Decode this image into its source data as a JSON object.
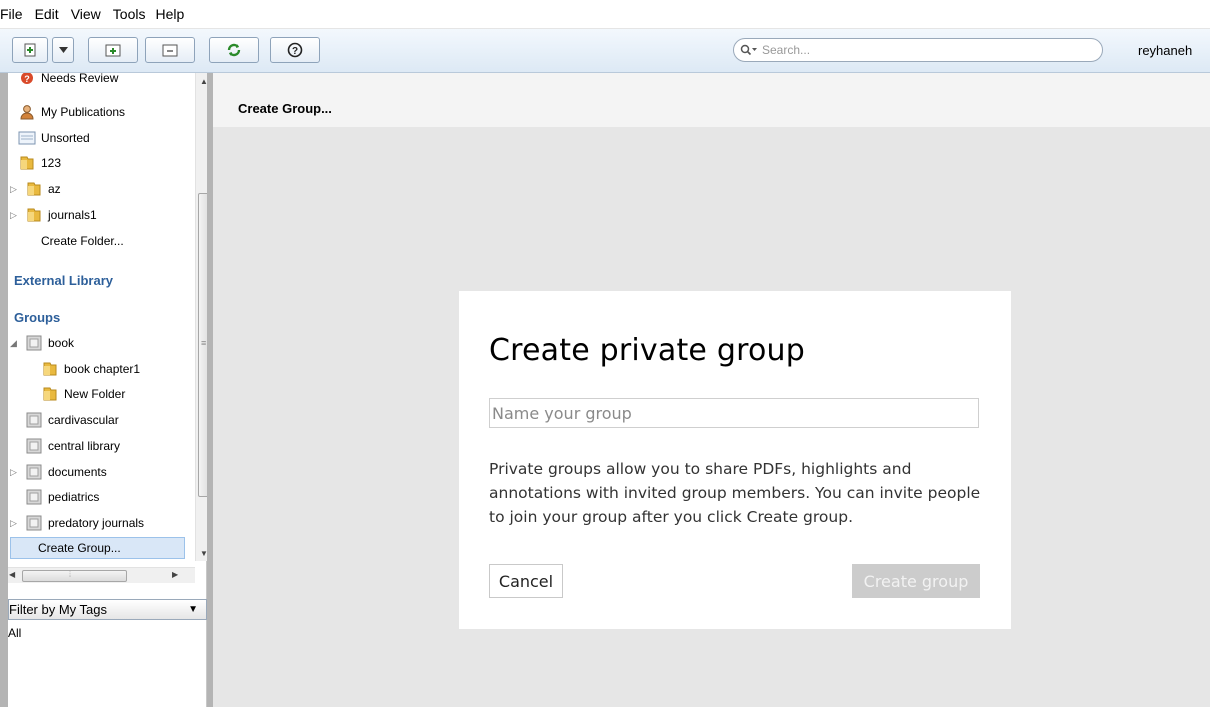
{
  "menu": [
    "File",
    "Edit",
    "View",
    "Tools",
    "Help"
  ],
  "toolbar": {
    "buttons": [
      "add-document-icon",
      "dropdown-arrow-icon",
      "new-folder-icon",
      "remove-folder-icon",
      "sync-icon",
      "help-icon"
    ],
    "search_placeholder": "Search...",
    "user": "reyhaneh"
  },
  "sidebar": {
    "library_items": [
      {
        "label": "Needs Review",
        "icon": "needs-review-icon"
      },
      {
        "label": "My Publications",
        "icon": "person-icon"
      },
      {
        "label": "Unsorted",
        "icon": "unsorted-icon"
      },
      {
        "label": "123",
        "icon": "folder-icon"
      },
      {
        "label": "az",
        "icon": "folder-icon"
      },
      {
        "label": "journals1",
        "icon": "folder-icon"
      },
      {
        "label": "Create Folder...",
        "icon": ""
      }
    ],
    "external_library": "External Library",
    "groups_title": "Groups",
    "groups": [
      {
        "label": "book"
      },
      {
        "label": "book chapter1"
      },
      {
        "label": "New Folder"
      },
      {
        "label": "cardivascular"
      },
      {
        "label": "central library"
      },
      {
        "label": "documents"
      },
      {
        "label": "pediatrics"
      },
      {
        "label": "predatory journals"
      },
      {
        "label": "Create Group..."
      }
    ],
    "filter_label": "Filter by My Tags",
    "filter_value": "All"
  },
  "main": {
    "title": "Create Group..."
  },
  "dialog": {
    "title": "Create private group",
    "name_placeholder": "Name your group",
    "description": "Private groups allow you to share PDFs, highlights and annotations with invited group members. You can invite people to join your group after you click Create group.",
    "cancel_label": "Cancel",
    "create_label": "Create group"
  }
}
